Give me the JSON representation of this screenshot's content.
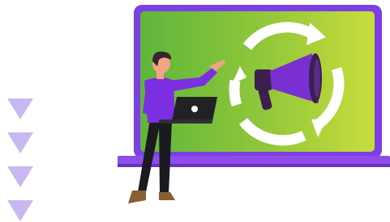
{
  "illustration": {
    "subject": "marketing-refresh",
    "icons": [
      "megaphone-icon",
      "refresh-cycle-icon",
      "laptop-icon",
      "down-arrow-icon"
    ]
  },
  "colors": {
    "screen_frame": "#7b3fe4",
    "screen_frame_dark": "#5b22b8",
    "screen_green_left": "#6fbe3c",
    "screen_green_right": "#c6dd3a",
    "stand_purple": "#8e4de8",
    "arrow_white": "#ffffff",
    "megaphone_purple": "#7a2fd0",
    "megaphone_dark": "#3a1f4f",
    "person_shirt": "#7b2fe0",
    "person_pants": "#1b1b1f",
    "person_skin": "#f2a585",
    "person_hair": "#3b2230",
    "laptop_dark": "#222226",
    "decor_triangle": "#c9b7f0"
  }
}
